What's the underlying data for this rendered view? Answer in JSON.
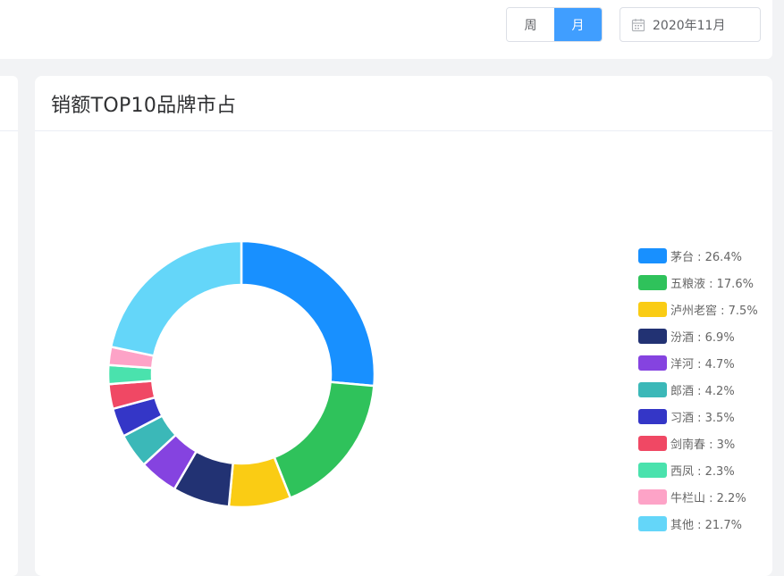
{
  "toolbar": {
    "period_options": [
      {
        "label": "周",
        "active": false
      },
      {
        "label": "月",
        "active": true
      }
    ],
    "date_value": "2020年11月"
  },
  "card": {
    "title": "销额TOP10品牌市占"
  },
  "colors": {
    "accent": "#409eff"
  },
  "chart_data": {
    "type": "pie",
    "subtype": "donut",
    "title": "销额TOP10品牌市占",
    "legend_position": "right",
    "series": [
      {
        "name": "茅台",
        "value": 26.4,
        "label": "茅台 : 26.4%",
        "color": "#1890ff"
      },
      {
        "name": "五粮液",
        "value": 17.6,
        "label": "五粮液 : 17.6%",
        "color": "#2fc25b"
      },
      {
        "name": "泸州老窖",
        "value": 7.5,
        "label": "泸州老窖 : 7.5%",
        "color": "#facc14"
      },
      {
        "name": "汾酒",
        "value": 6.9,
        "label": "汾酒 : 6.9%",
        "color": "#223273"
      },
      {
        "name": "洋河",
        "value": 4.7,
        "label": "洋河 : 4.7%",
        "color": "#8543e0"
      },
      {
        "name": "郎酒",
        "value": 4.2,
        "label": "郎酒 : 4.2%",
        "color": "#3bb8b8"
      },
      {
        "name": "习酒",
        "value": 3.5,
        "label": "习酒 : 3.5%",
        "color": "#3436c7"
      },
      {
        "name": "剑南春",
        "value": 3.0,
        "label": "剑南春 : 3%",
        "color": "#f04864"
      },
      {
        "name": "西凤",
        "value": 2.3,
        "label": "西凤 : 2.3%",
        "color": "#4ae2ad"
      },
      {
        "name": "牛栏山",
        "value": 2.2,
        "label": "牛栏山 : 2.2%",
        "color": "#fda3c7"
      },
      {
        "name": "其他",
        "value": 21.7,
        "label": "其他 : 21.7%",
        "color": "#64d6f9"
      }
    ]
  }
}
